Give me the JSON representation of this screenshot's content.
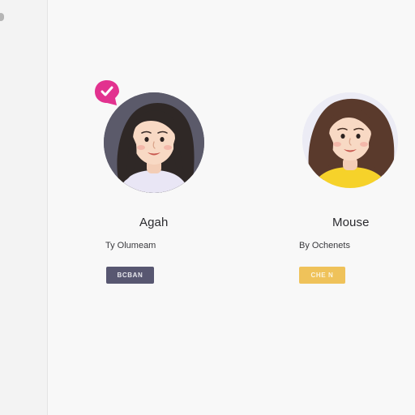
{
  "profiles": [
    {
      "name": "Agah",
      "subtitle": "Ty Olumeam",
      "button_label": "BCBAN",
      "badge_icon": "check-heart-badge-icon",
      "accent_color": "#585771",
      "badge_color": "#e2328f",
      "shirt_color": "#e9e6f5"
    },
    {
      "name": "Mouse",
      "subtitle": "By Ochenets",
      "button_label": "CHE N",
      "accent_color": "#efc25a",
      "shirt_color": "#f6d22a"
    }
  ]
}
